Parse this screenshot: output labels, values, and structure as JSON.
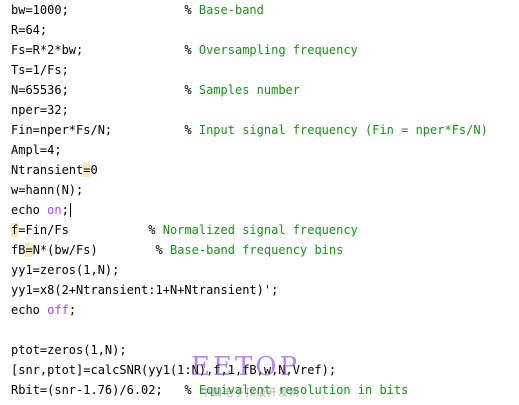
{
  "lines": {
    "l1": {
      "code": "bw=1000;                % ",
      "comment": "Base-band"
    },
    "l2": {
      "code": "R=64;"
    },
    "l3": {
      "code": "Fs=R*2*bw;              % ",
      "comment": "Oversampling frequency"
    },
    "l4": {
      "code": "Ts=1/Fs;"
    },
    "l5": {
      "code": "N=65536;                % ",
      "comment": "Samples number"
    },
    "l6": {
      "code": "nper=32;"
    },
    "l7": {
      "code": "Fin=nper*Fs/N;          % ",
      "comment": "Input signal frequency (Fin = nper*Fs/N)"
    },
    "l8": {
      "code": "Ampl=4;"
    },
    "l9": {
      "pre": "Ntransient",
      "hl": "=",
      "post": "0"
    },
    "l10": {
      "code": "w=hann(N);"
    },
    "l11": {
      "code": "echo ",
      "kw": "on",
      "post": ";"
    },
    "l12": {
      "hl": "f",
      "post": "=Fin/Fs           % ",
      "comment": "Normalized signal frequency"
    },
    "l13": {
      "pre": "fB",
      "hl": "=",
      "post": "N*(bw/Fs)        % ",
      "comment": "Base-band frequency bins"
    },
    "l14": {
      "code": "yy1=zeros(1,N);"
    },
    "l15": {
      "code": "yy1=x8(2+Ntransient:1+N+Ntransient)';"
    },
    "l16": {
      "code": "echo ",
      "kw": "off",
      "post": ";"
    },
    "l17": {
      "code": "ptot=zeros(1,N);"
    },
    "l18": {
      "code": "[snr,ptot]=calcSNR(yy1(1:N),f,1,fB,w,N,Vref);"
    },
    "l19": {
      "code": "Rbit=(snr-1.76)/6.02;   % ",
      "comment": "Equivalent resolution in bits"
    }
  },
  "watermark": {
    "logo": "EETOP",
    "subtitle": "中国电子顶级开发网"
  },
  "colors": {
    "keyword": "#b042ff",
    "comment": "#1a8f1a",
    "highlight": "#fbe7b8",
    "text": "#000000"
  }
}
